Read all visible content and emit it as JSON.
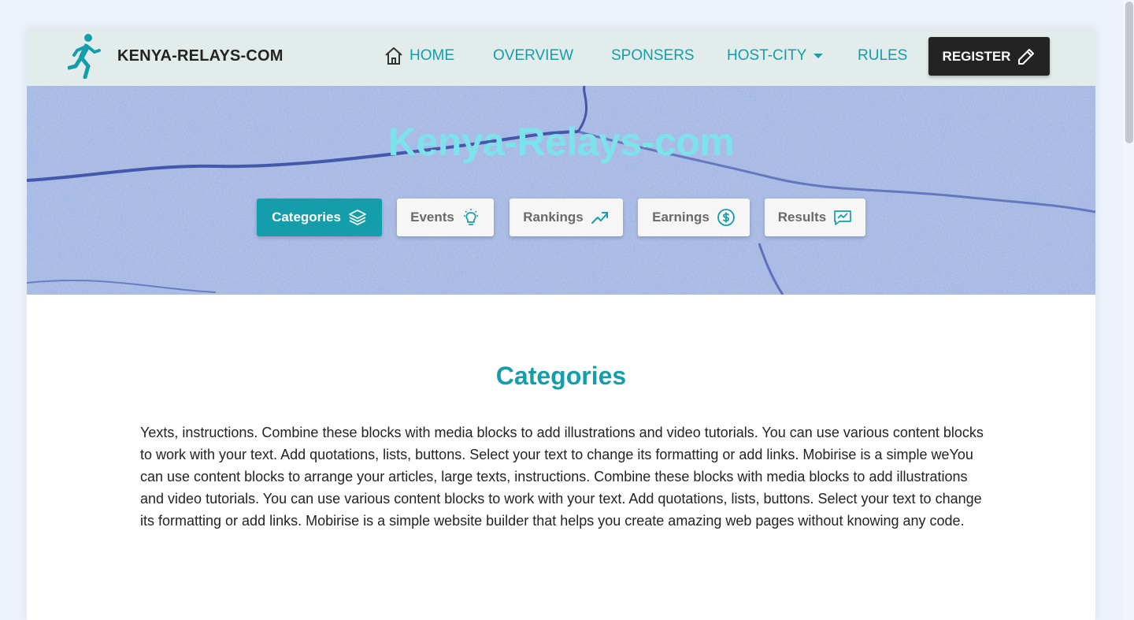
{
  "brand": {
    "name": "KENYA-RELAYS-COM",
    "logo_icon": "runner-icon"
  },
  "nav": {
    "items": [
      {
        "label": "HOME",
        "icon": "home-icon"
      },
      {
        "label": "OVERVIEW"
      },
      {
        "label": "SPONSERS"
      },
      {
        "label": "HOST-CITY",
        "icon": "caret-down-icon"
      },
      {
        "label": "RULES"
      }
    ],
    "register_label": "REGISTER",
    "register_icon": "pencil-icon"
  },
  "hero": {
    "title": "Kenya-Relays-com",
    "tabs": [
      {
        "label": "Categories",
        "icon": "layers-icon",
        "active": true
      },
      {
        "label": "Events",
        "icon": "lightbulb-icon",
        "active": false
      },
      {
        "label": "Rankings",
        "icon": "trending-up-icon",
        "active": false
      },
      {
        "label": "Earnings",
        "icon": "dollar-circle-icon",
        "active": false
      },
      {
        "label": "Results",
        "icon": "chart-message-icon",
        "active": false
      }
    ]
  },
  "content": {
    "title": "Categories",
    "body": "Yexts, instructions. Combine these blocks with media blocks to add illustrations and video tutorials. You can use various content blocks to work with your text. Add quotations, lists, buttons. Select your text to change its formatting or add links. Mobirise is a simple weYou can use content blocks to arrange your articles, large texts, instructions. Combine these blocks with media blocks to add illustrations and video tutorials. You can use various content blocks to work with your text. Add quotations, lists, buttons. Select your text to change its formatting or add links. Mobirise is a simple website builder that helps you create amazing web pages without knowing any code."
  },
  "colors": {
    "accent": "#149eab",
    "hero_title": "#7de3ea",
    "navbar_bg": "#e2ecea",
    "register_bg": "#232323",
    "page_bg": "#edf1fb"
  }
}
